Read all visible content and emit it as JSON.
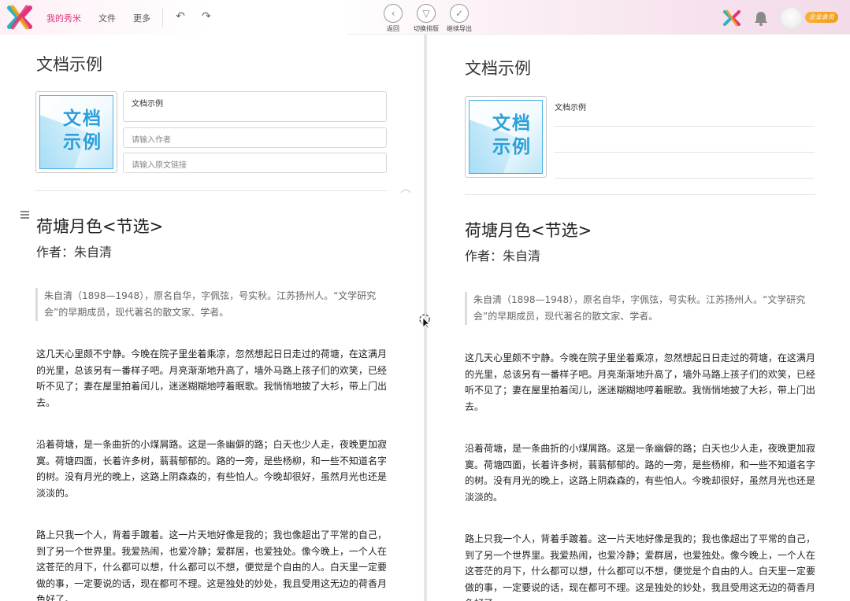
{
  "topbar": {
    "nav": [
      "我的秀米",
      "文件",
      "更多"
    ],
    "tools": [
      {
        "label": "返回",
        "icon": "back-circle-icon"
      },
      {
        "label": "切换排版",
        "icon": "switch-layout-icon"
      },
      {
        "label": "继续导出",
        "icon": "check-circle-icon"
      }
    ],
    "vip_label": "企业会员",
    "brand_colors": {
      "pink": "#e0357a",
      "teal": "#2bb3c0",
      "orange": "#f39c12",
      "blue": "#2a9fd8"
    }
  },
  "doc": {
    "title": "文档示例",
    "cover_text_line1": "文档",
    "cover_text_line2": "示例",
    "title_field_value": "文档示例",
    "author_placeholder": "请输入作者",
    "link_placeholder": "请输入原文链接"
  },
  "article": {
    "title": "荷塘月色<节选>",
    "author": "作者：朱自清",
    "quote": "朱自清（1898—1948），原名自华，字佩弦，号实秋。江苏扬州人。“文学研究会”的早期成员，现代著名的散文家、学者。",
    "paragraphs": [
      "这几天心里颇不宁静。今晚在院子里坐着乘凉，忽然想起日日走过的荷塘，在这满月的光里，总该另有一番样子吧。月亮渐渐地升高了，墙外马路上孩子们的欢笑，已经听不见了；妻在屋里拍着闰儿，迷迷糊糊地哼着眠歌。我悄悄地披了大衫，带上门出去。",
      "沿着荷塘，是一条曲折的小煤屑路。这是一条幽僻的路；白天也少人走，夜晚更加寂寞。荷塘四面，长着许多树，蓊蓊郁郁的。路的一旁，是些杨柳，和一些不知道名字的树。没有月光的晚上，这路上阴森森的，有些怕人。今晚却很好，虽然月光也还是淡淡的。",
      "路上只我一个人，背着手踱着。这一片天地好像是我的；我也像超出了平常的自己，到了另一个世界里。我爱热闹，也爱冷静；爱群居，也爱独处。像今晚上，一个人在这苍茫的月下，什么都可以想，什么都可以不想，便觉是个自由的人。白天里一定要做的事，一定要说的话，现在都可不理。这是独处的妙处，我且受用这无边的荷香月色好了。"
    ]
  }
}
